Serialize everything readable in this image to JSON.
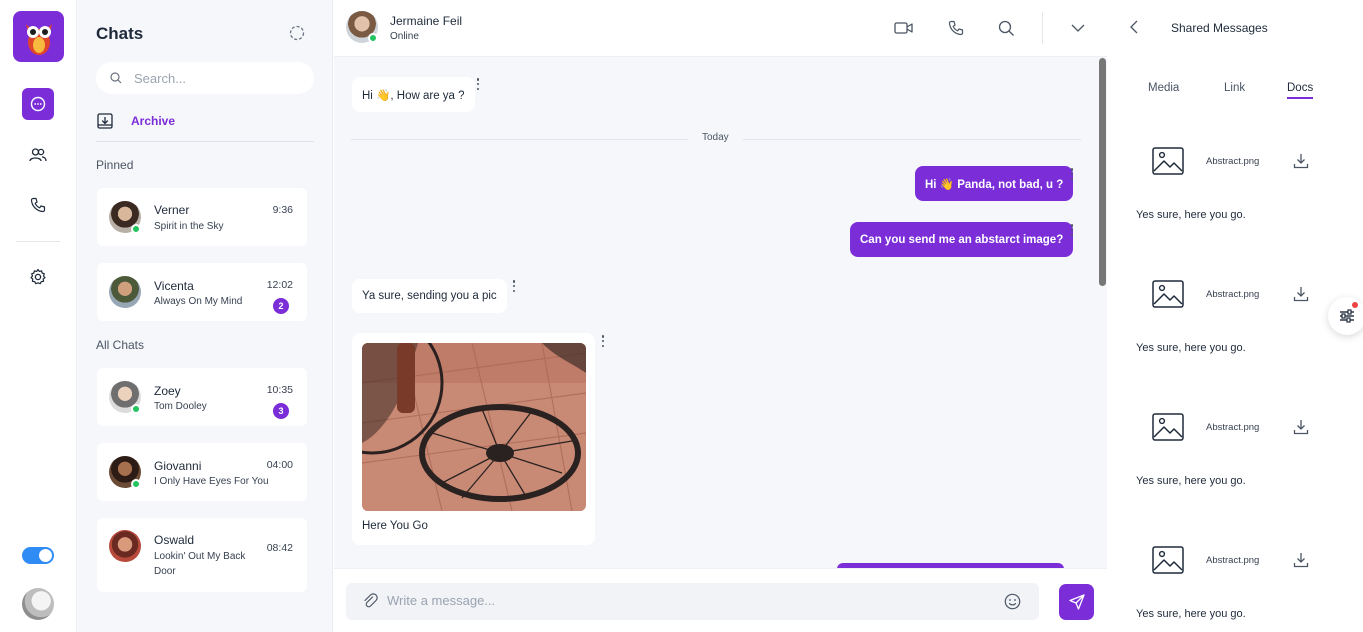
{
  "colors": {
    "accent": "#7b2ed8",
    "online": "#22c55e",
    "toggle": "#2f8cf5",
    "panel_bg": "#f5f7fb"
  },
  "rail": {
    "items": [
      {
        "name": "chat-icon",
        "active": true
      },
      {
        "name": "contacts-icon",
        "active": false
      },
      {
        "name": "phone-icon",
        "active": false
      },
      {
        "name": "settings-icon",
        "active": false
      }
    ],
    "theme_toggle_on": true
  },
  "chatlist": {
    "title": "Chats",
    "search_placeholder": "Search...",
    "archive_label": "Archive",
    "pinned_label": "Pinned",
    "all_label": "All Chats",
    "pinned": [
      {
        "name": "Verner",
        "message": "Spirit in the Sky",
        "time": "9:36",
        "online": true,
        "badge": ""
      },
      {
        "name": "Vicenta",
        "message": "Always On My Mind",
        "time": "12:02",
        "online": false,
        "badge": "2"
      }
    ],
    "all": [
      {
        "name": "Zoey",
        "message": "Tom Dooley",
        "time": "10:35",
        "online": true,
        "badge": "3"
      },
      {
        "name": "Giovanni",
        "message": "I Only Have Eyes For You",
        "time": "04:00",
        "online": true,
        "badge": ""
      },
      {
        "name": "Oswald",
        "message": "Lookin' Out My Back Door",
        "time": "08:42",
        "online": false,
        "badge": ""
      }
    ]
  },
  "conversation": {
    "contact_name": "Jermaine Feil",
    "contact_status": "Online",
    "day_label": "Today",
    "messages": [
      {
        "direction": "in",
        "text": "Hi 👋, How are ya ?"
      },
      {
        "direction": "out",
        "text": "Hi 👋 Panda, not bad, u ?"
      },
      {
        "direction": "out",
        "text": "Can you send me an abstarct image?"
      },
      {
        "direction": "in",
        "text": "Ya sure, sending you a pic"
      },
      {
        "direction": "in",
        "type": "image",
        "caption": "Here You Go"
      }
    ],
    "composer_placeholder": "Write a message..."
  },
  "shared": {
    "title": "Shared Messages",
    "tabs": [
      {
        "label": "Media",
        "active": false
      },
      {
        "label": "Link",
        "active": false
      },
      {
        "label": "Docs",
        "active": true
      }
    ],
    "docs": [
      {
        "file": "Abstract.png",
        "text": "Yes sure, here you go."
      },
      {
        "file": "Abstract.png",
        "text": "Yes sure, here you go."
      },
      {
        "file": "Abstract.png",
        "text": "Yes sure, here you go."
      },
      {
        "file": "Abstract.png",
        "text": "Yes sure, here you go."
      }
    ]
  }
}
